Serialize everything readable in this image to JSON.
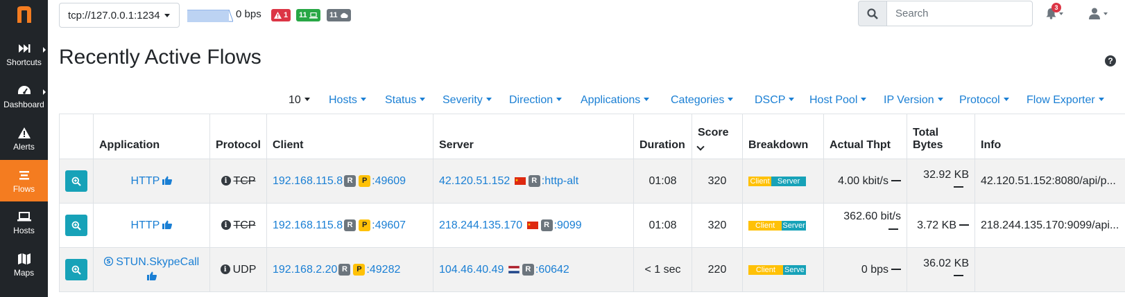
{
  "sidebar": {
    "logo": "n",
    "items": [
      {
        "label": "Shortcuts",
        "icon": "fast-forward-icon"
      },
      {
        "label": "Dashboard",
        "icon": "gauge-icon"
      },
      {
        "label": "Alerts",
        "icon": "warning-icon"
      },
      {
        "label": "Flows",
        "icon": "flows-icon"
      },
      {
        "label": "Hosts",
        "icon": "laptop-icon"
      },
      {
        "label": "Maps",
        "icon": "map-icon"
      }
    ]
  },
  "topbar": {
    "interface": "tcp://127.0.0.1:1234",
    "throughput": "0 bps",
    "alerts_count": "1",
    "local_hosts_count": "11",
    "remote_hosts_count": "11",
    "search_placeholder": "Search",
    "notifications_count": "3"
  },
  "page": {
    "title": "Recently Active Flows",
    "help": "?"
  },
  "filters": {
    "page_size": "10",
    "items": [
      "Hosts",
      "Status",
      "Severity",
      "Direction",
      "Applications",
      "Categories",
      "DSCP",
      "Host Pool",
      "IP Version",
      "Protocol",
      "Flow Exporter"
    ]
  },
  "table": {
    "headers": {
      "application": "Application",
      "protocol": "Protocol",
      "client": "Client",
      "server": "Server",
      "duration": "Duration",
      "score": "Score",
      "breakdown": "Breakdown",
      "thpt": "Actual Thpt",
      "bytes_line1": "Total",
      "bytes_line2": "Bytes",
      "info": "Info"
    },
    "rows": [
      {
        "application": "HTTP",
        "protocol": "TCP",
        "client_ip": "192.168.115.8",
        "client_port": ":49609",
        "server_ip": "42.120.51.152",
        "server_port": ":http-alt",
        "server_flag": "cn",
        "duration": "01:08",
        "score": "320",
        "breakdown_client": "Client",
        "breakdown_server": "Server",
        "breakdown_client_pct": 40,
        "thpt": "4.00 kbit/s",
        "bytes": "32.92 KB",
        "info": "42.120.51.152:8080/api/p..."
      },
      {
        "application": "HTTP",
        "protocol": "TCP",
        "client_ip": "192.168.115.8",
        "client_port": ":49607",
        "server_ip": "218.244.135.170",
        "server_port": ":9099",
        "server_flag": "cn",
        "duration": "01:08",
        "score": "320",
        "breakdown_client": "Client",
        "breakdown_server": "Server",
        "breakdown_client_pct": 58,
        "thpt": "362.60 bit/s",
        "bytes": "3.72 KB",
        "info": "218.244.135.170:9099/api..."
      },
      {
        "application": "STUN.SkypeCall",
        "protocol": "UDP",
        "client_ip": "192.168.2.20",
        "client_port": ":49282",
        "server_ip": "104.46.40.49",
        "server_port": ":60642",
        "server_flag": "nl",
        "duration": "< 1 sec",
        "score": "220",
        "breakdown_client": "Client",
        "breakdown_server": "Serve",
        "breakdown_client_pct": 60,
        "thpt": "0 bps",
        "bytes": "36.02 KB",
        "info": ""
      }
    ]
  },
  "colors": {
    "sidebar_bg": "#212529",
    "active_orange": "#f47c20",
    "link_blue": "#1a7fd4",
    "teal": "#17a2b8",
    "yellow": "#ffc107",
    "red": "#dc3545",
    "green": "#28a745",
    "grey": "#6c757d"
  }
}
